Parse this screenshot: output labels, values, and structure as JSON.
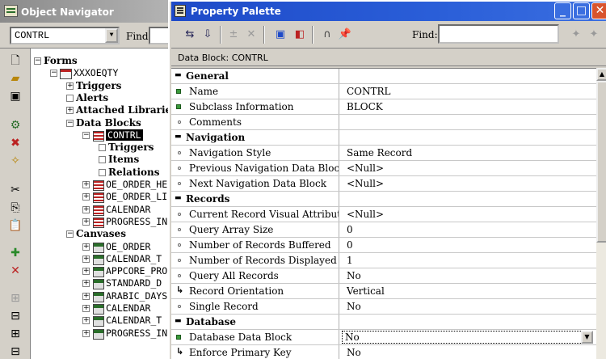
{
  "navigator": {
    "title": "Object Navigator",
    "module": "CONTRL",
    "find_label": "Find:",
    "tree": [
      {
        "label": "Forms",
        "bold": true,
        "exp": "−",
        "icon": null,
        "indent": 0
      },
      {
        "label": "XXXOEQTY",
        "bold": false,
        "exp": "−",
        "icon": "fm",
        "indent": 1
      },
      {
        "label": "Triggers",
        "bold": true,
        "exp": "+",
        "icon": null,
        "indent": 2
      },
      {
        "label": "Alerts",
        "bold": true,
        "exp": "·",
        "icon": null,
        "indent": 2
      },
      {
        "label": "Attached Libraries",
        "bold": true,
        "exp": "+",
        "icon": null,
        "indent": 2
      },
      {
        "label": "Data Blocks",
        "bold": true,
        "exp": "−",
        "icon": null,
        "indent": 2
      },
      {
        "label": "CONTRL",
        "bold": false,
        "exp": "−",
        "icon": "db",
        "indent": 3,
        "selected": true
      },
      {
        "label": "Triggers",
        "bold": true,
        "exp": "·",
        "icon": null,
        "indent": 4
      },
      {
        "label": "Items",
        "bold": true,
        "exp": "·",
        "icon": null,
        "indent": 4
      },
      {
        "label": "Relations",
        "bold": true,
        "exp": "·",
        "icon": null,
        "indent": 4
      },
      {
        "label": "OE_ORDER_HE",
        "bold": false,
        "exp": "+",
        "icon": "db",
        "indent": 3
      },
      {
        "label": "OE_ORDER_LI",
        "bold": false,
        "exp": "+",
        "icon": "db",
        "indent": 3
      },
      {
        "label": "CALENDAR",
        "bold": false,
        "exp": "+",
        "icon": "db",
        "indent": 3
      },
      {
        "label": "PROGRESS_IN",
        "bold": false,
        "exp": "+",
        "icon": "db",
        "indent": 3
      },
      {
        "label": "Canvases",
        "bold": true,
        "exp": "−",
        "icon": null,
        "indent": 2
      },
      {
        "label": "OE_ORDER",
        "bold": false,
        "exp": "+",
        "icon": "cv",
        "indent": 3
      },
      {
        "label": "CALENDAR_T",
        "bold": false,
        "exp": "+",
        "icon": "cv",
        "indent": 3
      },
      {
        "label": "APPCORE_PRO",
        "bold": false,
        "exp": "+",
        "icon": "cv",
        "indent": 3
      },
      {
        "label": "STANDARD_D",
        "bold": false,
        "exp": "+",
        "icon": "cv",
        "indent": 3
      },
      {
        "label": "ARABIC_DAYS",
        "bold": false,
        "exp": "+",
        "icon": "cv",
        "indent": 3
      },
      {
        "label": "CALENDAR",
        "bold": false,
        "exp": "+",
        "icon": "cv",
        "indent": 3
      },
      {
        "label": "CALENDAR_T",
        "bold": false,
        "exp": "+",
        "icon": "cv",
        "indent": 3
      },
      {
        "label": "PROGRESS_IN",
        "bold": false,
        "exp": "+",
        "icon": "cv",
        "indent": 3
      }
    ]
  },
  "palette": {
    "title": "Property Palette",
    "find_label": "Find:",
    "context": "Data Block: CONTRL",
    "window_buttons": {
      "minimize": "_",
      "maximize": "□",
      "close": "✕"
    },
    "rows": [
      {
        "type": "section",
        "name": "General"
      },
      {
        "type": "prop",
        "bullet": "g",
        "name": "Name",
        "value": "CONTRL"
      },
      {
        "type": "prop",
        "bullet": "g",
        "name": "Subclass Information",
        "value": "BLOCK"
      },
      {
        "type": "prop",
        "bullet": "o",
        "name": "Comments",
        "value": ""
      },
      {
        "type": "section",
        "name": "Navigation"
      },
      {
        "type": "prop",
        "bullet": "o",
        "name": "Navigation Style",
        "value": "Same Record"
      },
      {
        "type": "prop",
        "bullet": "o",
        "name": "Previous Navigation Data Block",
        "value": "<Null>"
      },
      {
        "type": "prop",
        "bullet": "o",
        "name": "Next Navigation Data Block",
        "value": "<Null>"
      },
      {
        "type": "section",
        "name": "Records"
      },
      {
        "type": "prop",
        "bullet": "o",
        "name": "Current Record Visual Attribute Grou",
        "value": "<Null>"
      },
      {
        "type": "prop",
        "bullet": "o",
        "name": "Query Array Size",
        "value": "0"
      },
      {
        "type": "prop",
        "bullet": "o",
        "name": "Number of Records Buffered",
        "value": "0"
      },
      {
        "type": "prop",
        "bullet": "o",
        "name": "Number of Records Displayed",
        "value": "1"
      },
      {
        "type": "prop",
        "bullet": "o",
        "name": "Query All Records",
        "value": "No"
      },
      {
        "type": "prop",
        "bullet": "a",
        "name": "Record Orientation",
        "value": "Vertical"
      },
      {
        "type": "prop",
        "bullet": "o",
        "name": "Single Record",
        "value": "No"
      },
      {
        "type": "section",
        "name": "Database"
      },
      {
        "type": "prop",
        "bullet": "g",
        "name": "Database Data Block",
        "value": "No",
        "active": true
      },
      {
        "type": "prop",
        "bullet": "a",
        "name": "Enforce Primary Key",
        "value": "No"
      }
    ]
  },
  "colors": {
    "title_active": "#1e4ac8",
    "title_inactive": "#8a8a8a",
    "selection": "#000000"
  }
}
